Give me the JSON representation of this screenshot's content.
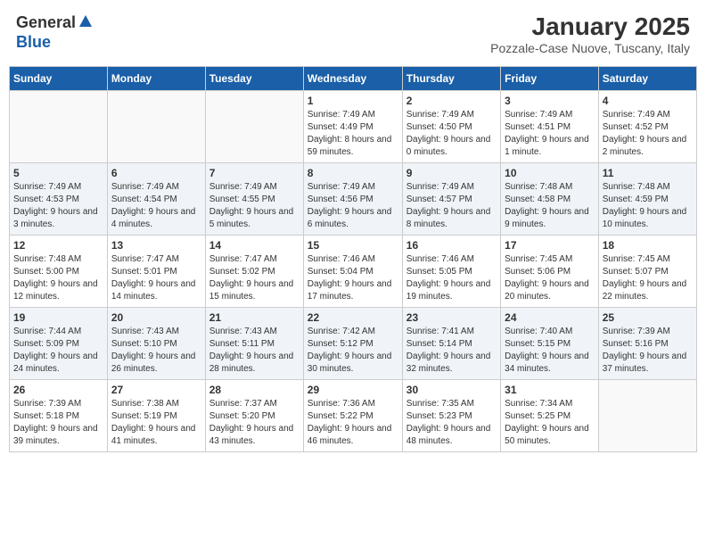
{
  "header": {
    "logo_general": "General",
    "logo_blue": "Blue",
    "month_title": "January 2025",
    "location": "Pozzale-Case Nuove, Tuscany, Italy"
  },
  "weekdays": [
    "Sunday",
    "Monday",
    "Tuesday",
    "Wednesday",
    "Thursday",
    "Friday",
    "Saturday"
  ],
  "weeks": [
    [
      {
        "day": "",
        "sunrise": "",
        "sunset": "",
        "daylight": "",
        "empty": true
      },
      {
        "day": "",
        "sunrise": "",
        "sunset": "",
        "daylight": "",
        "empty": true
      },
      {
        "day": "",
        "sunrise": "",
        "sunset": "",
        "daylight": "",
        "empty": true
      },
      {
        "day": "1",
        "sunrise": "Sunrise: 7:49 AM",
        "sunset": "Sunset: 4:49 PM",
        "daylight": "Daylight: 8 hours and 59 minutes."
      },
      {
        "day": "2",
        "sunrise": "Sunrise: 7:49 AM",
        "sunset": "Sunset: 4:50 PM",
        "daylight": "Daylight: 9 hours and 0 minutes."
      },
      {
        "day": "3",
        "sunrise": "Sunrise: 7:49 AM",
        "sunset": "Sunset: 4:51 PM",
        "daylight": "Daylight: 9 hours and 1 minute."
      },
      {
        "day": "4",
        "sunrise": "Sunrise: 7:49 AM",
        "sunset": "Sunset: 4:52 PM",
        "daylight": "Daylight: 9 hours and 2 minutes."
      }
    ],
    [
      {
        "day": "5",
        "sunrise": "Sunrise: 7:49 AM",
        "sunset": "Sunset: 4:53 PM",
        "daylight": "Daylight: 9 hours and 3 minutes."
      },
      {
        "day": "6",
        "sunrise": "Sunrise: 7:49 AM",
        "sunset": "Sunset: 4:54 PM",
        "daylight": "Daylight: 9 hours and 4 minutes."
      },
      {
        "day": "7",
        "sunrise": "Sunrise: 7:49 AM",
        "sunset": "Sunset: 4:55 PM",
        "daylight": "Daylight: 9 hours and 5 minutes."
      },
      {
        "day": "8",
        "sunrise": "Sunrise: 7:49 AM",
        "sunset": "Sunset: 4:56 PM",
        "daylight": "Daylight: 9 hours and 6 minutes."
      },
      {
        "day": "9",
        "sunrise": "Sunrise: 7:49 AM",
        "sunset": "Sunset: 4:57 PM",
        "daylight": "Daylight: 9 hours and 8 minutes."
      },
      {
        "day": "10",
        "sunrise": "Sunrise: 7:48 AM",
        "sunset": "Sunset: 4:58 PM",
        "daylight": "Daylight: 9 hours and 9 minutes."
      },
      {
        "day": "11",
        "sunrise": "Sunrise: 7:48 AM",
        "sunset": "Sunset: 4:59 PM",
        "daylight": "Daylight: 9 hours and 10 minutes."
      }
    ],
    [
      {
        "day": "12",
        "sunrise": "Sunrise: 7:48 AM",
        "sunset": "Sunset: 5:00 PM",
        "daylight": "Daylight: 9 hours and 12 minutes."
      },
      {
        "day": "13",
        "sunrise": "Sunrise: 7:47 AM",
        "sunset": "Sunset: 5:01 PM",
        "daylight": "Daylight: 9 hours and 14 minutes."
      },
      {
        "day": "14",
        "sunrise": "Sunrise: 7:47 AM",
        "sunset": "Sunset: 5:02 PM",
        "daylight": "Daylight: 9 hours and 15 minutes."
      },
      {
        "day": "15",
        "sunrise": "Sunrise: 7:46 AM",
        "sunset": "Sunset: 5:04 PM",
        "daylight": "Daylight: 9 hours and 17 minutes."
      },
      {
        "day": "16",
        "sunrise": "Sunrise: 7:46 AM",
        "sunset": "Sunset: 5:05 PM",
        "daylight": "Daylight: 9 hours and 19 minutes."
      },
      {
        "day": "17",
        "sunrise": "Sunrise: 7:45 AM",
        "sunset": "Sunset: 5:06 PM",
        "daylight": "Daylight: 9 hours and 20 minutes."
      },
      {
        "day": "18",
        "sunrise": "Sunrise: 7:45 AM",
        "sunset": "Sunset: 5:07 PM",
        "daylight": "Daylight: 9 hours and 22 minutes."
      }
    ],
    [
      {
        "day": "19",
        "sunrise": "Sunrise: 7:44 AM",
        "sunset": "Sunset: 5:09 PM",
        "daylight": "Daylight: 9 hours and 24 minutes."
      },
      {
        "day": "20",
        "sunrise": "Sunrise: 7:43 AM",
        "sunset": "Sunset: 5:10 PM",
        "daylight": "Daylight: 9 hours and 26 minutes."
      },
      {
        "day": "21",
        "sunrise": "Sunrise: 7:43 AM",
        "sunset": "Sunset: 5:11 PM",
        "daylight": "Daylight: 9 hours and 28 minutes."
      },
      {
        "day": "22",
        "sunrise": "Sunrise: 7:42 AM",
        "sunset": "Sunset: 5:12 PM",
        "daylight": "Daylight: 9 hours and 30 minutes."
      },
      {
        "day": "23",
        "sunrise": "Sunrise: 7:41 AM",
        "sunset": "Sunset: 5:14 PM",
        "daylight": "Daylight: 9 hours and 32 minutes."
      },
      {
        "day": "24",
        "sunrise": "Sunrise: 7:40 AM",
        "sunset": "Sunset: 5:15 PM",
        "daylight": "Daylight: 9 hours and 34 minutes."
      },
      {
        "day": "25",
        "sunrise": "Sunrise: 7:39 AM",
        "sunset": "Sunset: 5:16 PM",
        "daylight": "Daylight: 9 hours and 37 minutes."
      }
    ],
    [
      {
        "day": "26",
        "sunrise": "Sunrise: 7:39 AM",
        "sunset": "Sunset: 5:18 PM",
        "daylight": "Daylight: 9 hours and 39 minutes."
      },
      {
        "day": "27",
        "sunrise": "Sunrise: 7:38 AM",
        "sunset": "Sunset: 5:19 PM",
        "daylight": "Daylight: 9 hours and 41 minutes."
      },
      {
        "day": "28",
        "sunrise": "Sunrise: 7:37 AM",
        "sunset": "Sunset: 5:20 PM",
        "daylight": "Daylight: 9 hours and 43 minutes."
      },
      {
        "day": "29",
        "sunrise": "Sunrise: 7:36 AM",
        "sunset": "Sunset: 5:22 PM",
        "daylight": "Daylight: 9 hours and 46 minutes."
      },
      {
        "day": "30",
        "sunrise": "Sunrise: 7:35 AM",
        "sunset": "Sunset: 5:23 PM",
        "daylight": "Daylight: 9 hours and 48 minutes."
      },
      {
        "day": "31",
        "sunrise": "Sunrise: 7:34 AM",
        "sunset": "Sunset: 5:25 PM",
        "daylight": "Daylight: 9 hours and 50 minutes."
      },
      {
        "day": "",
        "sunrise": "",
        "sunset": "",
        "daylight": "",
        "empty": true
      }
    ]
  ]
}
